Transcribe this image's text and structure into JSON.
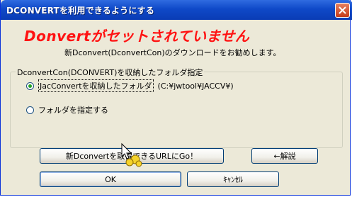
{
  "window": {
    "title": "DCONVERTを利用できるようにする"
  },
  "message": {
    "headline": "Donvertがセットされていません",
    "subline": "新Dconvert(DconvertCon)のダウンロードをお勧めします。"
  },
  "group": {
    "legend": "DconvertCon(DCONVERT)を収納したフォルダ指定",
    "options": [
      {
        "label": "JacConvertを収納したフォルダ",
        "path": "(C:¥jwtool¥JACCV¥)",
        "checked": true
      },
      {
        "label": "フォルダを指定する",
        "checked": false
      }
    ]
  },
  "buttons": {
    "get_url": "新Dconvertを取得できるURLにGo！",
    "explain": "←解説",
    "ok": "OK",
    "cancel": "ｷｬﾝｾﾙ"
  }
}
